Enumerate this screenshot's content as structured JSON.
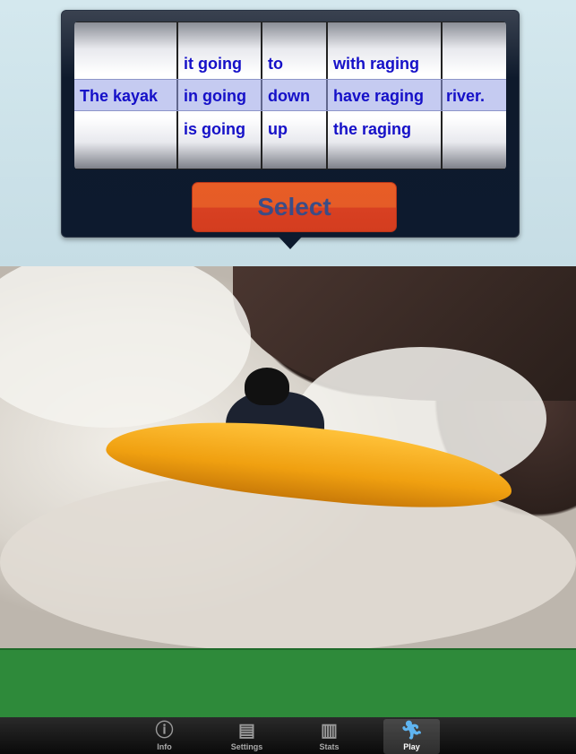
{
  "picker": {
    "columns": [
      {
        "above": "",
        "selected": "The kayak",
        "below": ""
      },
      {
        "above": "it going",
        "selected": "in going",
        "below": "is going"
      },
      {
        "above": "to",
        "selected": "down",
        "below": "up"
      },
      {
        "above": "with raging",
        "selected": "have raging",
        "below": "the raging"
      },
      {
        "above": "",
        "selected": "river.",
        "below": ""
      }
    ]
  },
  "select_label": "Select",
  "colors": {
    "accent": "#e55c27",
    "picker_text": "#1510c8",
    "grass": "#2e8a3a"
  },
  "tabs": [
    {
      "label": "Info",
      "icon": "info-icon"
    },
    {
      "label": "Settings",
      "icon": "inbox-tray-icon"
    },
    {
      "label": "Stats",
      "icon": "bar-chart-icon"
    },
    {
      "label": "Play",
      "icon": "running-person-icon",
      "active": true
    }
  ]
}
